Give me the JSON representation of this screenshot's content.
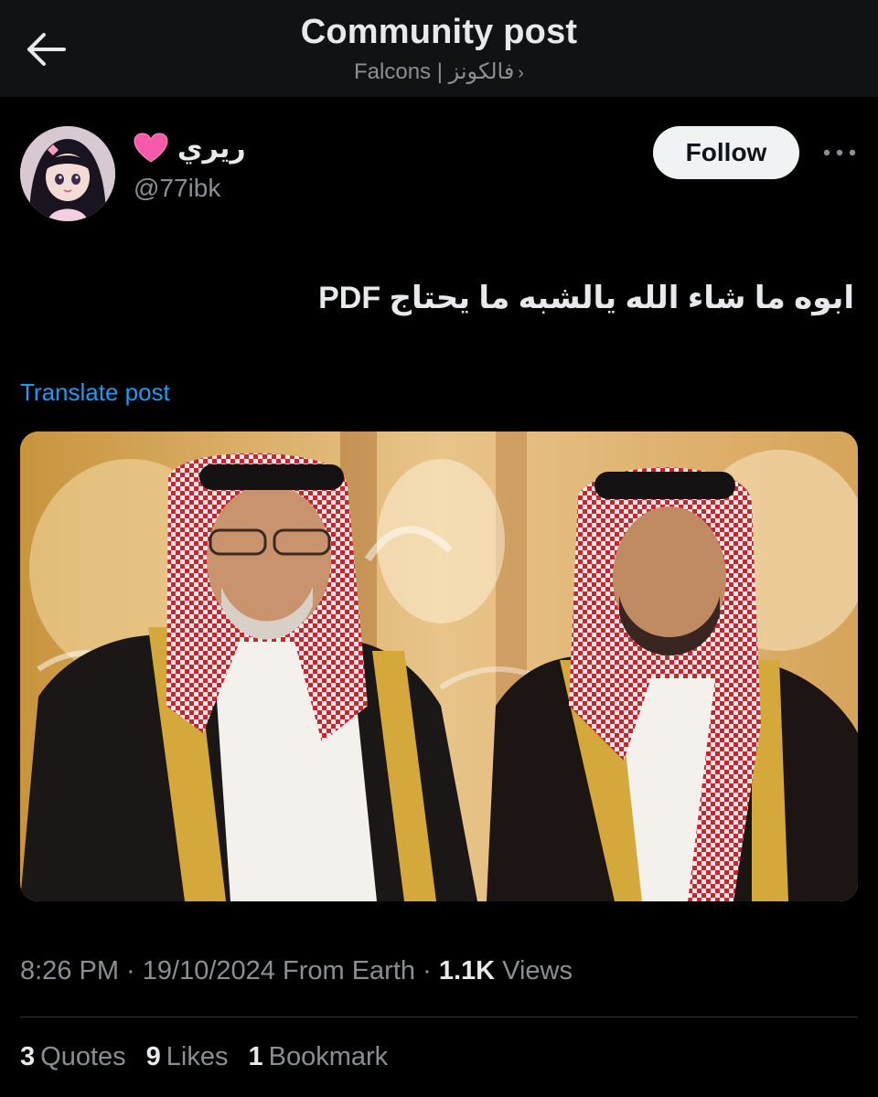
{
  "header": {
    "title": "Community post",
    "subtitle": "Falcons | فالكونز",
    "subtitle_chevron": "›",
    "back_icon": "arrow-left-icon"
  },
  "author": {
    "display_name": "ريري",
    "handle": "@77ibk",
    "badge_icon": "pink-heart-icon",
    "follow_label": "Follow",
    "more_icon": "ellipsis-icon"
  },
  "post": {
    "text": "ابوه ما شاء الله يالشبه ما يحتاج PDF",
    "translate_label": "Translate post",
    "media_description_icon": "photo"
  },
  "meta": {
    "time": "8:26 PM",
    "sep1": " · ",
    "date": "19/10/2024",
    "source": " From Earth",
    "sep2": " · ",
    "views_count": "1.1K",
    "views_label": " Views"
  },
  "stats": {
    "quotes_count": "3",
    "quotes_label": "Quotes",
    "likes_count": "9",
    "likes_label": "Likes",
    "bookmarks_count": "1",
    "bookmarks_label": "Bookmark"
  },
  "colors": {
    "background": "#000000",
    "header_bg": "#111214",
    "link_blue": "#1d9bf0",
    "muted_text": "#8b8f94",
    "primary_text": "#e7e9ea"
  }
}
